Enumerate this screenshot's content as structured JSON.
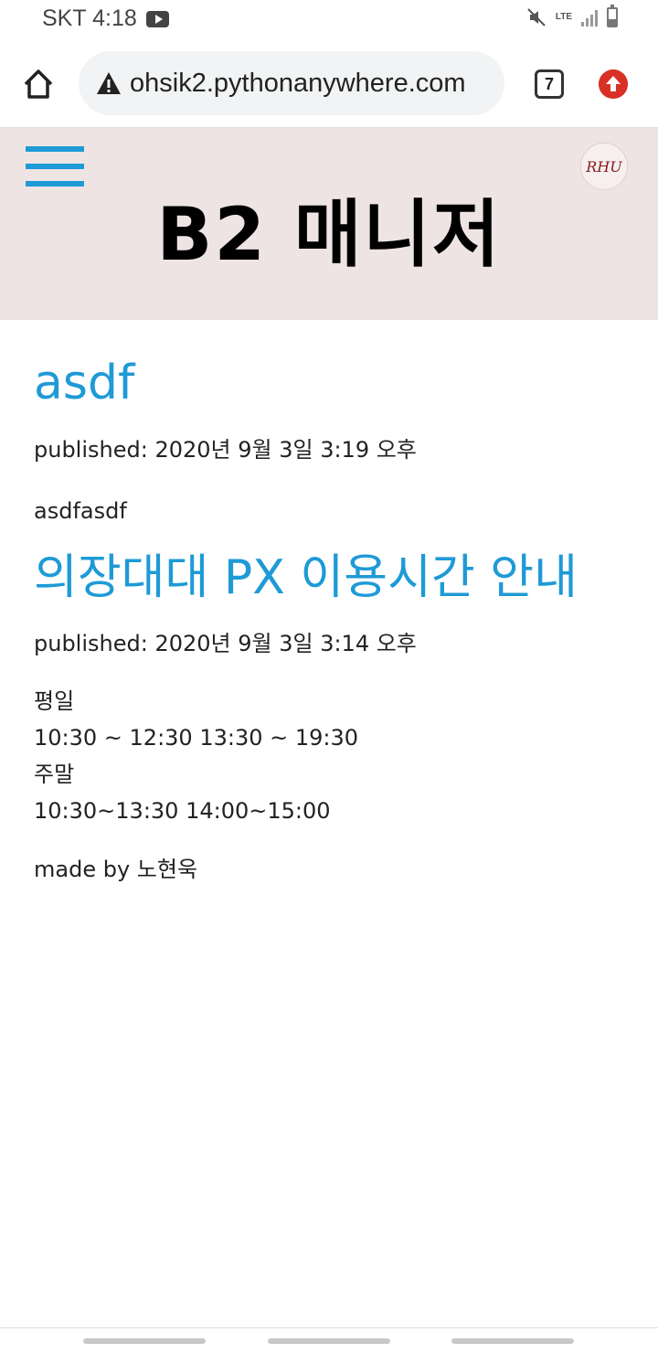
{
  "status_bar": {
    "carrier_time": "SKT 4:18",
    "network": "LTE"
  },
  "browser": {
    "url": "ohsik2.pythonanywhere.com",
    "tab_count": "7"
  },
  "header": {
    "title": "B2 매니저",
    "logo_text": "RHU"
  },
  "posts": [
    {
      "title": "asdf",
      "published": "published: 2020년 9월 3일 3:19 오후",
      "body_lines": [
        "asdfasdf"
      ]
    },
    {
      "title": "의장대대 PX 이용시간 안내",
      "published": "published: 2020년 9월 3일 3:14 오후",
      "body_lines": [
        "평일",
        "10:30 ~ 12:30 13:30 ~ 19:30",
        "주말",
        "10:30~13:30 14:00~15:00"
      ]
    }
  ],
  "footer": {
    "credit": "made by 노현욱"
  },
  "colors": {
    "accent": "#1e9ad6",
    "header_bg": "#efe4e4",
    "update_red": "#d93025"
  }
}
